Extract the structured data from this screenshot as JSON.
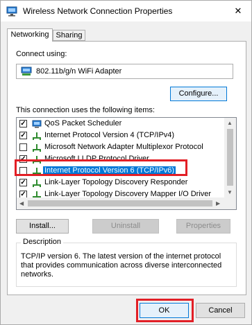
{
  "window": {
    "title": "Wireless Network Connection Properties",
    "close_glyph": "✕"
  },
  "tabs": [
    {
      "label": "Networking",
      "active": true
    },
    {
      "label": "Sharing",
      "active": false
    }
  ],
  "connect_using": {
    "label": "Connect using:",
    "adapter_name": "802.11b/g/n WiFi Adapter",
    "configure_button": "Configure..."
  },
  "items_section": {
    "label": "This connection uses the following items:",
    "items": [
      {
        "label": "QoS Packet Scheduler",
        "checked": true,
        "icon": "scheduler-icon"
      },
      {
        "label": "Internet Protocol Version 4 (TCP/IPv4)",
        "checked": true,
        "icon": "protocol-icon"
      },
      {
        "label": "Microsoft Network Adapter Multiplexor Protocol",
        "checked": false,
        "icon": "protocol-icon"
      },
      {
        "label": "Microsoft LLDP Protocol Driver",
        "checked": true,
        "icon": "protocol-icon"
      },
      {
        "label": "Internet Protocol Version 6 (TCP/IPv6)",
        "checked": false,
        "icon": "protocol-icon",
        "selected": true
      },
      {
        "label": "Link-Layer Topology Discovery Responder",
        "checked": true,
        "icon": "protocol-icon"
      },
      {
        "label": "Link-Layer Topology Discovery Mapper I/O Driver",
        "checked": true,
        "icon": "protocol-icon"
      }
    ]
  },
  "actions": {
    "install": "Install...",
    "uninstall": "Uninstall",
    "properties": "Properties"
  },
  "description": {
    "legend": "Description",
    "text": "TCP/IP version 6. The latest version of the internet protocol that provides communication across diverse interconnected networks."
  },
  "footer": {
    "ok": "OK",
    "cancel": "Cancel"
  },
  "colors": {
    "selection": "#0078d7",
    "highlight_outline": "#e21f26"
  }
}
